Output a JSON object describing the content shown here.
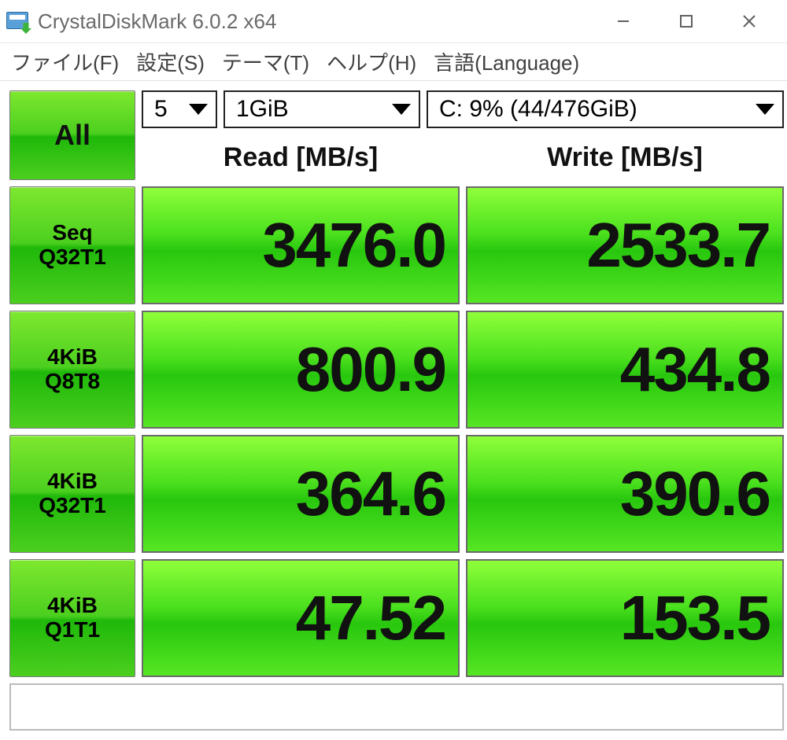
{
  "window": {
    "title": "CrystalDiskMark 6.0.2 x64"
  },
  "menu": {
    "file": "ファイル(F)",
    "settings": "設定(S)",
    "theme": "テーマ(T)",
    "help": "ヘルプ(H)",
    "language": "言語(Language)"
  },
  "controls": {
    "all_label": "All",
    "runs": "5",
    "size": "1GiB",
    "drive": "C: 9% (44/476GiB)"
  },
  "columns": {
    "read": "Read [MB/s]",
    "write": "Write [MB/s]"
  },
  "tests": [
    {
      "label_line1": "Seq",
      "label_line2": "Q32T1",
      "read": "3476.0",
      "write": "2533.7"
    },
    {
      "label_line1": "4KiB",
      "label_line2": "Q8T8",
      "read": "800.9",
      "write": "434.8"
    },
    {
      "label_line1": "4KiB",
      "label_line2": "Q32T1",
      "read": "364.6",
      "write": "390.6"
    },
    {
      "label_line1": "4KiB",
      "label_line2": "Q1T1",
      "read": "47.52",
      "write": "153.5"
    }
  ]
}
